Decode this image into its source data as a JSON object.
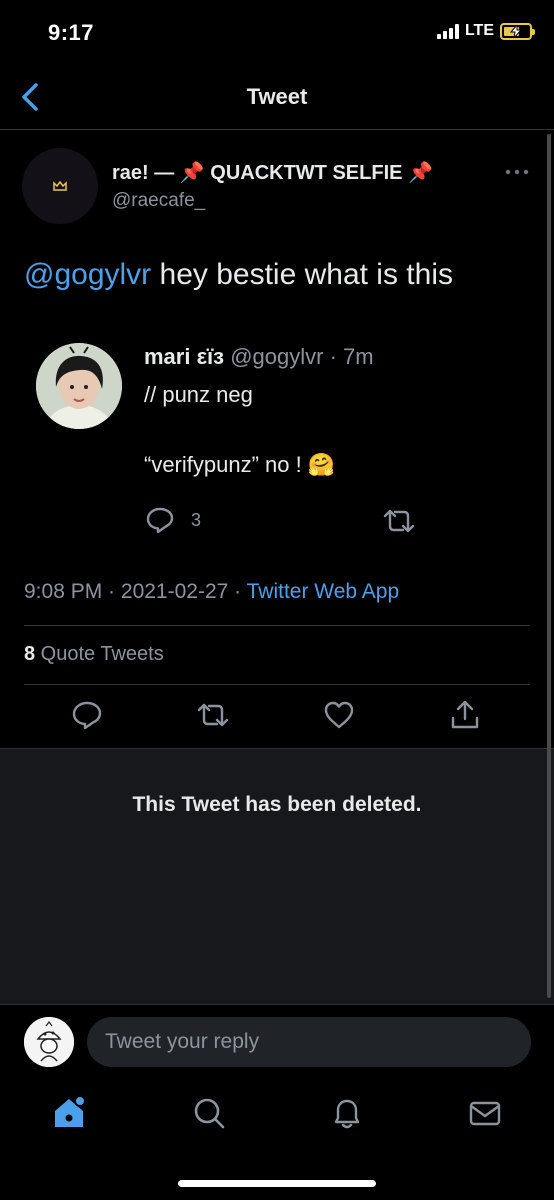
{
  "status_bar": {
    "time": "9:17",
    "network": "LTE"
  },
  "nav": {
    "title": "Tweet"
  },
  "tweet": {
    "author_name": "rae! — 📌 QUACKTWT SELFIE 📌",
    "author_handle": "@raecafe_",
    "mention": "@gogylvr",
    "text": " hey bestie what is this",
    "time": "9:08 PM",
    "separator": " · ",
    "date": "2021-02-27",
    "source": "Twitter Web App",
    "quote_count": "8",
    "quote_label": " Quote Tweets"
  },
  "quoted": {
    "name": "mari ε‍ïз",
    "handle": "@gogylvr",
    "age": "· 7m",
    "line1": "// punz neg",
    "line2": "“verifypunz” no !",
    "emoji": "🤗",
    "reply_count": "3"
  },
  "deleted": {
    "message": "This Tweet has been deleted."
  },
  "reply": {
    "placeholder": "Tweet your reply"
  },
  "colors": {
    "accent": "#4ba0eb",
    "background": "#000000",
    "muted": "#8b949e",
    "panel": "#16181c"
  },
  "icons": [
    "back-chevron-icon",
    "more-icon",
    "reply-icon",
    "retweet-icon",
    "like-icon",
    "share-icon",
    "home-icon",
    "search-icon",
    "notifications-icon",
    "messages-icon"
  ]
}
